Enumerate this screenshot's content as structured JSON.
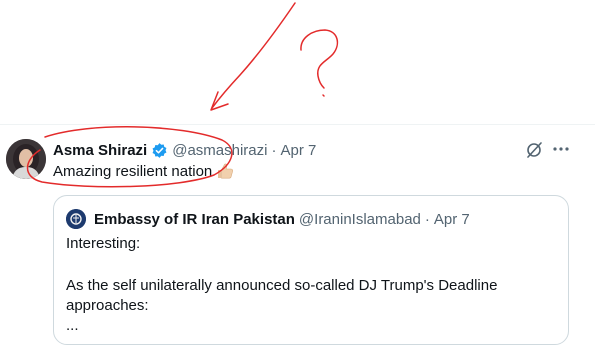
{
  "tweet": {
    "author_name": "Asma Shirazi",
    "author_handle": "@asmashirazi",
    "separator": "·",
    "date": "Apr 7",
    "text": "Amazing resilient nation"
  },
  "quoted_tweet": {
    "author_name": "Embassy of IR Iran Pakistan",
    "author_handle": "@IraninIslamabad",
    "separator": "·",
    "date": "Apr 7",
    "lines": [
      "Interesting:",
      "As the self unilaterally announced so-called DJ Trump's Deadline",
      "approaches:",
      "..."
    ]
  },
  "annotation": {
    "question_mark": "?",
    "color": "#e32b2b"
  },
  "colors": {
    "verified_badge": "#1d9bf0",
    "secondary_text": "#536471",
    "border": "#cfd9de"
  },
  "icons": [
    "verified-badge-icon",
    "grok-icon",
    "more-icon",
    "thumbs-up-emoji-icon"
  ]
}
